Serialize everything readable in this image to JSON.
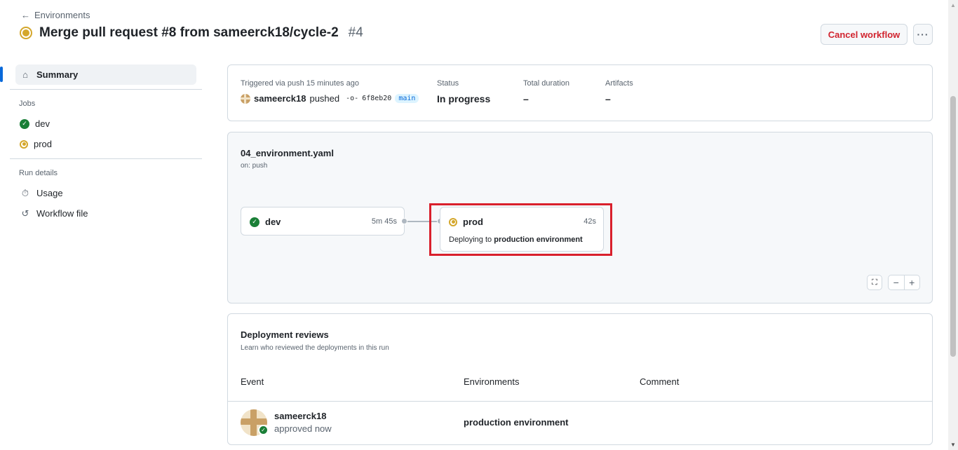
{
  "header": {
    "back_label": "Environments",
    "title": "Merge pull request #8 from sameerck18/cycle-2",
    "run_number": "#4",
    "cancel_label": "Cancel workflow",
    "more_label": "···"
  },
  "sidebar": {
    "summary_label": "Summary",
    "jobs_heading": "Jobs",
    "jobs": [
      {
        "label": "dev",
        "status": "success"
      },
      {
        "label": "prod",
        "status": "in_progress"
      }
    ],
    "run_details_heading": "Run details",
    "run_details": [
      {
        "label": "Usage",
        "icon": "stopwatch-icon"
      },
      {
        "label": "Workflow file",
        "icon": "file-code-icon"
      }
    ]
  },
  "summary": {
    "trigger_label": "Triggered via push 15 minutes ago",
    "actor": "sameerck18",
    "action": "pushed",
    "commit": "6f8eb20",
    "branch": "main",
    "status_label": "Status",
    "status_value": "In progress",
    "duration_label": "Total duration",
    "duration_value": "–",
    "artifacts_label": "Artifacts",
    "artifacts_value": "–"
  },
  "workflow": {
    "file": "04_environment.yaml",
    "trigger": "on: push",
    "jobs": [
      {
        "name": "dev",
        "time": "5m 45s",
        "status": "success"
      },
      {
        "name": "prod",
        "time": "42s",
        "status": "in_progress",
        "deploy_prefix": "Deploying to",
        "deploy_env": "production environment"
      }
    ]
  },
  "reviews": {
    "title": "Deployment reviews",
    "subtitle": "Learn who reviewed the deployments in this run",
    "columns": [
      "Event",
      "Environments",
      "Comment"
    ],
    "rows": [
      {
        "user": "sameerck18",
        "action": "approved now",
        "environment": "production environment",
        "comment": ""
      }
    ]
  },
  "colors": {
    "accent": "#0969da",
    "success": "#1a7f37",
    "in_progress": "#d4a72c",
    "danger": "#d1242f",
    "highlight": "#d9202c"
  }
}
